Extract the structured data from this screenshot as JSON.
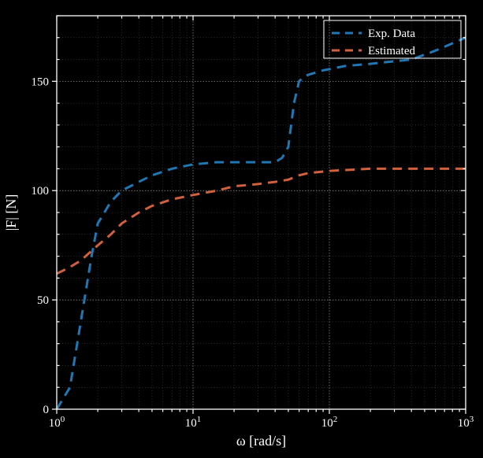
{
  "chart_data": {
    "type": "line",
    "xlabel": "ω [rad/s]",
    "ylabel": "|F| [N]",
    "title": "",
    "xlim": [
      1,
      1000
    ],
    "ylim": [
      0,
      180
    ],
    "xscale": "log",
    "yscale": "linear",
    "x_major_ticks": [
      1,
      10,
      100,
      1000
    ],
    "x_major_tick_labels": [
      "10^0",
      "10^1",
      "10^2",
      "10^3"
    ],
    "y_major_ticks": [
      0,
      50,
      100,
      150
    ],
    "grid_major": true,
    "grid_minor": true,
    "legend_position": "top-right",
    "series": [
      {
        "name": "Exp. Data",
        "color": "#1f77b4",
        "x": [
          1,
          1.25,
          1.5,
          1.8,
          2,
          2.5,
          3,
          4,
          5,
          7,
          10,
          15,
          20,
          30,
          40,
          45,
          50,
          55,
          60,
          65,
          70,
          90,
          130,
          200,
          400,
          600,
          1000
        ],
        "y": [
          0,
          10,
          40,
          70,
          85,
          95,
          100,
          104,
          107,
          110,
          112,
          113,
          113,
          113,
          113,
          115,
          120,
          140,
          150,
          152,
          153,
          155,
          157,
          158,
          160,
          164,
          170
        ]
      },
      {
        "name": "Estimated",
        "color": "#d1603d",
        "x": [
          1,
          1.25,
          1.5,
          2,
          2.5,
          3,
          4,
          5,
          7,
          10,
          15,
          20,
          30,
          40,
          50,
          60,
          70,
          100,
          200,
          400,
          1000
        ],
        "y": [
          62,
          65,
          68,
          75,
          80,
          85,
          90,
          93,
          96,
          98,
          100,
          102,
          103,
          104,
          105,
          107,
          108,
          109,
          110,
          110,
          110
        ]
      }
    ]
  }
}
